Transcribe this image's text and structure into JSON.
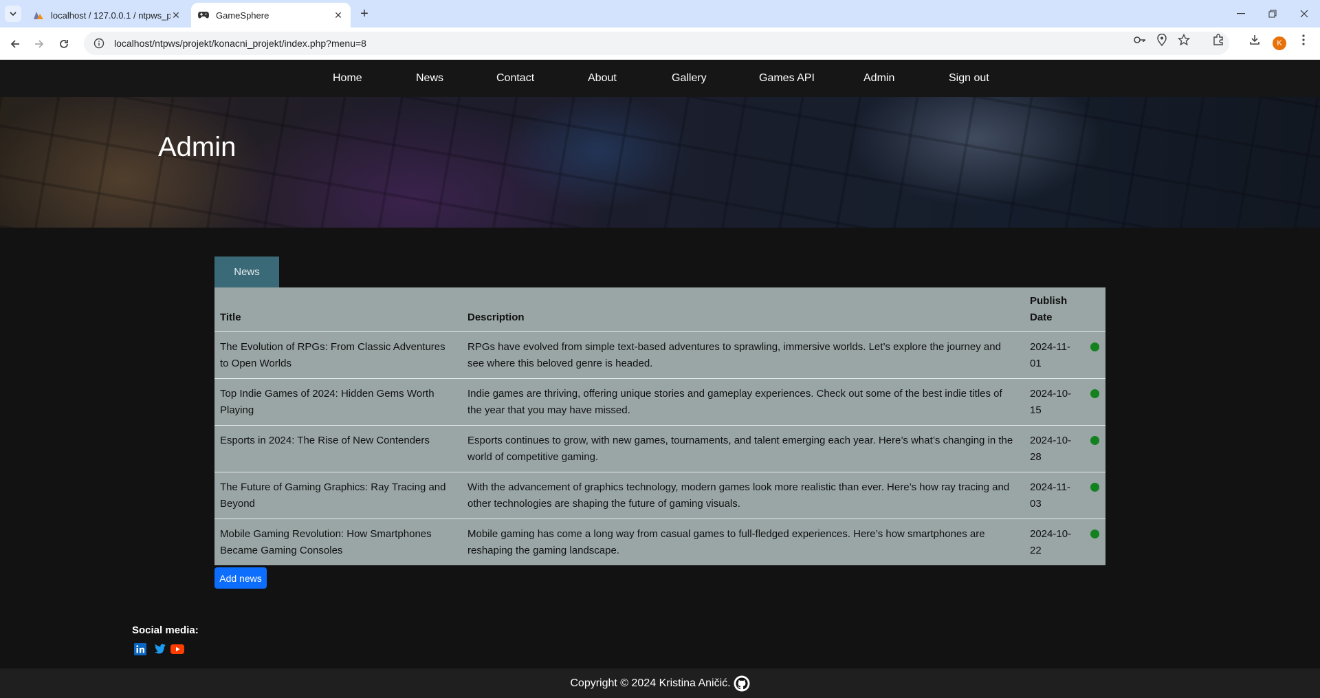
{
  "browser": {
    "tabs": [
      {
        "title": "localhost / 127.0.0.1 / ntpws_pr",
        "favicon": "phpmyadmin-icon"
      },
      {
        "title": "GameSphere",
        "favicon": "gamepad-icon",
        "active": true
      }
    ],
    "url": "localhost/ntpws/projekt/konacni_projekt/index.php?menu=8",
    "profile_initial": "K",
    "accent": "#d3e3fd"
  },
  "nav": {
    "items": [
      "Home",
      "News",
      "Contact",
      "About",
      "Gallery",
      "Games API",
      "Admin",
      "Sign out"
    ]
  },
  "hero": {
    "title": "Admin"
  },
  "admin": {
    "tab_label": "News",
    "table": {
      "headers": [
        "Title",
        "Description",
        "Publish Date",
        ""
      ],
      "rows": [
        {
          "title": "The Evolution of RPGs: From Classic Adventures to Open Worlds",
          "description": "RPGs have evolved from simple text-based adventures to sprawling, immersive worlds. Let’s explore the journey and see where this beloved genre is headed.",
          "date": "2024-11-01",
          "status": "active"
        },
        {
          "title": "Top Indie Games of 2024: Hidden Gems Worth Playing",
          "description": "Indie games are thriving, offering unique stories and gameplay experiences. Check out some of the best indie titles of the year that you may have missed.",
          "date": "2024-10-15",
          "status": "active"
        },
        {
          "title": "Esports in 2024: The Rise of New Contenders",
          "description": "Esports continues to grow, with new games, tournaments, and talent emerging each year. Here’s what’s changing in the world of competitive gaming.",
          "date": "2024-10-28",
          "status": "active"
        },
        {
          "title": "The Future of Gaming Graphics: Ray Tracing and Beyond",
          "description": "With the advancement of graphics technology, modern games look more realistic than ever. Here’s how ray tracing and other technologies are shaping the future of gaming visuals.",
          "date": "2024-11-03",
          "status": "active"
        },
        {
          "title": "Mobile Gaming Revolution: How Smartphones Became Gaming Consoles",
          "description": "Mobile gaming has come a long way from casual games to full-fledged experiences. Here’s how smartphones are reshaping the gaming landscape.",
          "date": "2024-10-22",
          "status": "active"
        }
      ]
    },
    "add_button": "Add news",
    "status_color": "#12811e"
  },
  "social": {
    "label": "Social media:",
    "icons": [
      "linkedin-icon",
      "twitter-icon",
      "youtube-icon"
    ]
  },
  "footer": {
    "copyright": "Copyright © 2024 Kristina Aničić."
  }
}
